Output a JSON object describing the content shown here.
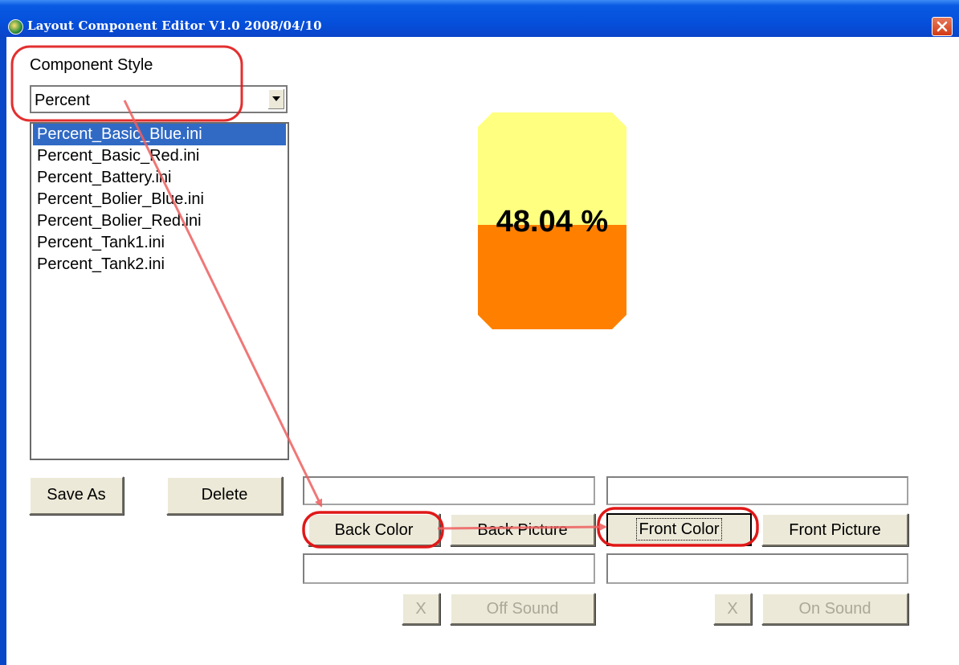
{
  "window": {
    "title": "Layout Component Editor V1.0  2008/04/10"
  },
  "component_style": {
    "label": "Component Style",
    "selected": "Percent"
  },
  "files": {
    "items": [
      "Percent_Basic_Blue.ini",
      "Percent_Basic_Red.ini",
      "Percent_Battery.ini",
      "Percent_Bolier_Blue.ini",
      "Percent_Bolier_Red.ini",
      "Percent_Tank1.ini",
      "Percent_Tank2.ini"
    ],
    "selected_index": 0
  },
  "preview": {
    "value_text": "48.04 %",
    "fill_fraction": 0.4804,
    "back_color": "#ffff80",
    "front_color": "#ff8000"
  },
  "buttons": {
    "save_as": "Save As",
    "delete": "Delete",
    "back_color": "Back Color",
    "back_picture": "Back Picture",
    "front_color": "Front Color",
    "front_picture": "Front Picture",
    "x_off": "X",
    "off_sound": "Off Sound",
    "x_on": "X",
    "on_sound": "On Sound"
  },
  "annotation_color": "#e02020"
}
